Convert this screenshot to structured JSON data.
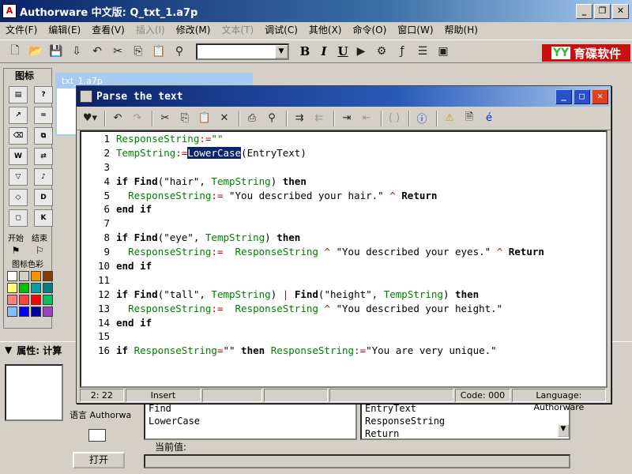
{
  "window": {
    "title": "Authorware 中文版: Q_txt_1.a7p"
  },
  "menu": [
    "文件(F)",
    "编辑(E)",
    "查看(V)",
    "插入(I)",
    "修改(M)",
    "文本(T)",
    "调试(C)",
    "其他(X)",
    "命令(O)",
    "窗口(W)",
    "帮助(H)"
  ],
  "menu_disabled": [
    false,
    false,
    false,
    true,
    false,
    true,
    false,
    false,
    false,
    false,
    false
  ],
  "toolbar": {
    "bold": "B",
    "italic": "I",
    "underline": "U"
  },
  "logo": {
    "text": "育碟软件",
    "mark": "YY"
  },
  "palette": {
    "title": "图标",
    "start_label": "开始",
    "end_label": "结束",
    "colors_label": "图标色彩",
    "swatches": [
      "#ffffff",
      "#d4d0c8",
      "#ff9000",
      "#804000",
      "#ffff80",
      "#00c000",
      "#00a0a0",
      "#008080",
      "#ff8080",
      "#ff4040",
      "#ff0000",
      "#00c060",
      "#80c0ff",
      "#0000ff",
      "#0000a0",
      "#a040c0"
    ]
  },
  "design_window": {
    "title": "txt_1.a7p"
  },
  "properties": {
    "header": "属性: 计算",
    "lang_label": "语言",
    "lang_value": "Authorwa",
    "left_list": [
      "Find",
      "LowerCase"
    ],
    "right_list": [
      "EntryText",
      "ResponseString",
      "Return"
    ],
    "current_value_label": "当前值:",
    "open_button": "打开"
  },
  "dialog": {
    "title": "Parse the text",
    "status": {
      "position": "2: 22",
      "mode": "Insert",
      "code": "Code: 000",
      "language": "Language: Authorware"
    }
  },
  "code_lines": [
    {
      "n": "1",
      "parts": [
        [
          "g",
          "ResponseString"
        ],
        [
          "r",
          ":="
        ],
        [
          "g",
          "\"\""
        ]
      ]
    },
    {
      "n": "2",
      "parts": [
        [
          "g",
          "TempString"
        ],
        [
          "r",
          ":="
        ],
        [
          "sel",
          "LowerCase"
        ],
        [
          "",
          "(EntryText)"
        ]
      ]
    },
    {
      "n": "3",
      "parts": []
    },
    {
      "n": "4",
      "parts": [
        [
          "b",
          "if Find"
        ],
        [
          "",
          "(\"hair\", "
        ],
        [
          "g",
          "TempString"
        ],
        [
          "",
          ") "
        ],
        [
          "b",
          "then"
        ]
      ]
    },
    {
      "n": "5",
      "parts": [
        [
          "",
          "  "
        ],
        [
          "g",
          "ResponseString"
        ],
        [
          "r",
          ":="
        ],
        [
          "",
          " \"You described your hair.\" "
        ],
        [
          "r",
          "^"
        ],
        [
          "",
          " "
        ],
        [
          "b",
          "Return"
        ]
      ]
    },
    {
      "n": "6",
      "parts": [
        [
          "b",
          "end if"
        ]
      ]
    },
    {
      "n": "7",
      "parts": []
    },
    {
      "n": "8",
      "parts": [
        [
          "b",
          "if Find"
        ],
        [
          "",
          "(\"eye\", "
        ],
        [
          "g",
          "TempString"
        ],
        [
          "",
          ") "
        ],
        [
          "b",
          "then"
        ]
      ]
    },
    {
      "n": "9",
      "parts": [
        [
          "",
          "  "
        ],
        [
          "g",
          "ResponseString"
        ],
        [
          "r",
          ":="
        ],
        [
          "",
          "  "
        ],
        [
          "g",
          "ResponseString"
        ],
        [
          "",
          " "
        ],
        [
          "r",
          "^"
        ],
        [
          "",
          " \"You described your eyes.\" "
        ],
        [
          "r",
          "^"
        ],
        [
          "",
          " "
        ],
        [
          "b",
          "Return"
        ]
      ]
    },
    {
      "n": "10",
      "parts": [
        [
          "b",
          "end if"
        ]
      ]
    },
    {
      "n": "11",
      "parts": []
    },
    {
      "n": "12",
      "parts": [
        [
          "b",
          "if Find"
        ],
        [
          "",
          "(\"tall\", "
        ],
        [
          "g",
          "TempString"
        ],
        [
          "",
          ") "
        ],
        [
          "r",
          "|"
        ],
        [
          "",
          " "
        ],
        [
          "b",
          "Find"
        ],
        [
          "",
          "(\"height\", "
        ],
        [
          "g",
          "TempString"
        ],
        [
          "",
          ") "
        ],
        [
          "b",
          "then"
        ]
      ]
    },
    {
      "n": "13",
      "parts": [
        [
          "",
          "  "
        ],
        [
          "g",
          "ResponseString"
        ],
        [
          "r",
          ":="
        ],
        [
          "",
          "  "
        ],
        [
          "g",
          "ResponseString"
        ],
        [
          "",
          " "
        ],
        [
          "r",
          "^"
        ],
        [
          "",
          " \"You described your height.\""
        ]
      ]
    },
    {
      "n": "14",
      "parts": [
        [
          "b",
          "end if"
        ]
      ]
    },
    {
      "n": "15",
      "parts": []
    },
    {
      "n": "16",
      "parts": [
        [
          "b",
          "if "
        ],
        [
          "g",
          "ResponseString"
        ],
        [
          "r",
          "="
        ],
        [
          "",
          "\"\" "
        ],
        [
          "b",
          "then"
        ],
        [
          "",
          " "
        ],
        [
          "g",
          "ResponseString"
        ],
        [
          "r",
          ":="
        ],
        [
          "",
          "\"You are very unique.\""
        ]
      ]
    }
  ]
}
